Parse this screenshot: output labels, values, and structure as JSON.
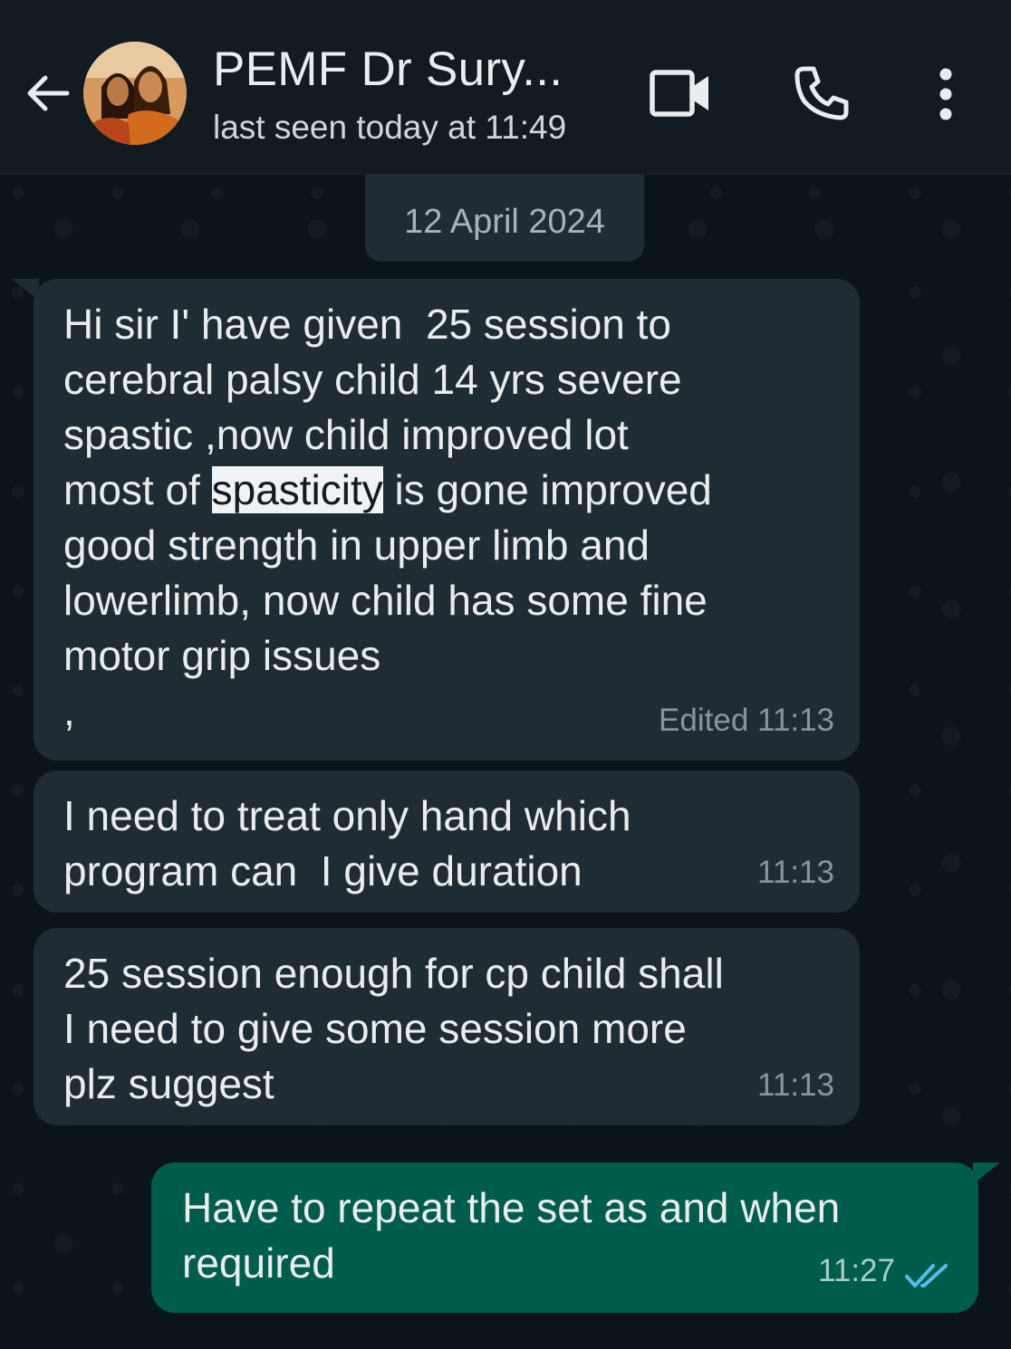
{
  "header": {
    "contact_name": "PEMF Dr  Sury...",
    "status": "last seen today at 11:49",
    "icons": [
      "back-arrow-icon",
      "video-call-icon",
      "voice-call-icon",
      "more-vert-icon"
    ]
  },
  "chat": {
    "date_chip": "12 April 2024",
    "messages": [
      {
        "direction": "incoming",
        "text_before": "Hi sir I' have given  25 session to\ncerebral palsy child 14 yrs severe\nspastic ,now child improved lot\nmost of ",
        "highlight": "spasticity",
        "text_after": " is gone improved\ngood strength in upper limb and\nlowerlimb, now child has some fine\nmotor grip issues\n,",
        "time": "Edited 11:13"
      },
      {
        "direction": "incoming",
        "text": "I need to treat only hand which\nprogram can  I give duration",
        "time": "11:13"
      },
      {
        "direction": "incoming",
        "text": "25 session enough for cp child shall\nI need to give some session more\nplz suggest",
        "time": "11:13"
      },
      {
        "direction": "outgoing",
        "text": "Have to repeat the set as and when\nrequired",
        "time": "11:27",
        "status": "read"
      }
    ]
  },
  "colors": {
    "header_bg": "#111b21",
    "chat_bg": "#0b141a",
    "incoming_bubble": "#202c33",
    "outgoing_bubble": "#005c4b",
    "read_ticks": "#53bdeb"
  }
}
